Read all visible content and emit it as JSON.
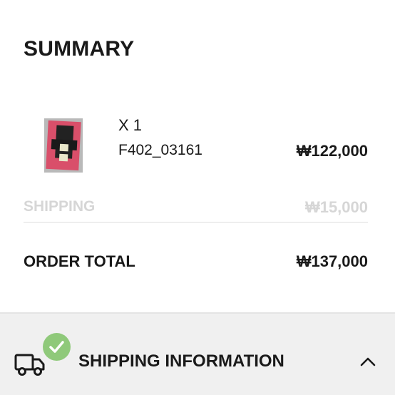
{
  "summary": {
    "title": "SUMMARY"
  },
  "item": {
    "quantity": "X 1",
    "sku": "F402_03161",
    "price": "₩122,000",
    "thumbnail_icon": "product-thumbnail",
    "accent_color": "#d94f6a"
  },
  "shipping": {
    "label": "SHIPPING",
    "value": "₩15,000"
  },
  "order_total": {
    "label": "ORDER TOTAL",
    "value": "₩137,000"
  },
  "shipping_information": {
    "label": "SHIPPING INFORMATION",
    "status_icon": "check-icon",
    "status_color": "#8fc97a",
    "lead_icon": "truck-icon",
    "toggle_icon": "chevron-up-icon"
  }
}
